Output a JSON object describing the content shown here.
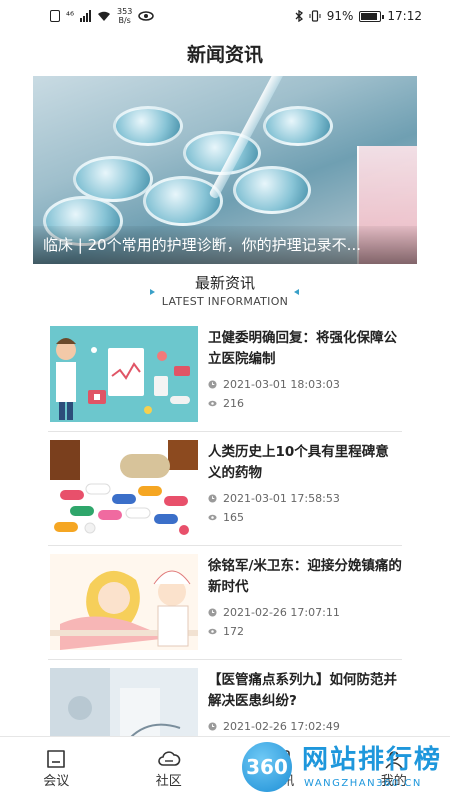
{
  "status_bar": {
    "network": "⁴⁶",
    "speed_value": "353",
    "speed_unit": "B/s",
    "battery": "91%",
    "time": "17:12"
  },
  "header": {
    "title": "新闻资讯"
  },
  "banner": {
    "caption": "临床 | 20个常用的护理诊断，你的护理记录不..."
  },
  "section": {
    "title": "最新资讯",
    "subtitle": "LATEST INFORMATION"
  },
  "news": [
    {
      "title": "卫健委明确回复：将强化保障公立医院编制",
      "date": "2021-03-01 18:03:03",
      "views": "216"
    },
    {
      "title": "人类历史上10个具有里程碑意义的药物",
      "date": "2021-03-01 17:58:53",
      "views": "165"
    },
    {
      "title": "徐铭军/米卫东：迎接分娩镇痛的新时代",
      "date": "2021-02-26 17:07:11",
      "views": "172"
    },
    {
      "title": "【医管痛点系列九】如何防范并解决医患纠纷?",
      "date": "2021-02-26 17:02:49",
      "views": ""
    }
  ],
  "tabs": [
    {
      "label": "会议",
      "icon": "meeting-icon"
    },
    {
      "label": "社区",
      "icon": "cloud-icon"
    },
    {
      "label": "资讯",
      "icon": "news-icon"
    },
    {
      "label": "我的",
      "icon": "profile-icon"
    }
  ],
  "watermark": {
    "logo": "360",
    "name": "网站排行榜",
    "url": "WANGZHAN360.CN"
  },
  "colors": {
    "accent": "#3aa0c8",
    "watermark": "#1e97dc"
  }
}
